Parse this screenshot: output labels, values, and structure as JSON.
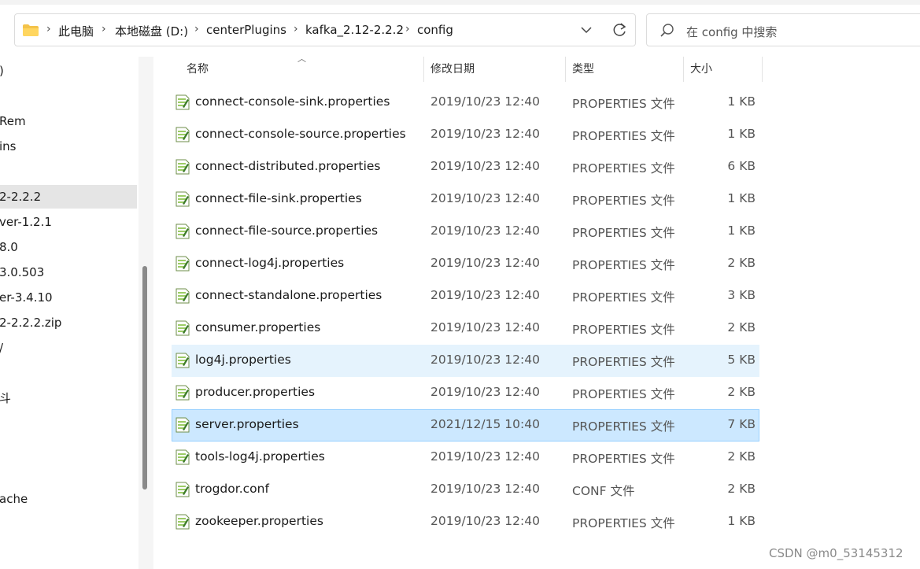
{
  "address_bar": {
    "breadcrumbs": [
      "此电脑",
      "本地磁盘 (D:)",
      "centerPlugins",
      "kafka_2.12-2.2.2",
      "config"
    ]
  },
  "search": {
    "placeholder": "在 config 中搜索"
  },
  "nav_pane": {
    "items": [
      {
        "label": ")",
        "selected": false
      },
      {
        "label": "Rem",
        "selected": false
      },
      {
        "label": "ins",
        "selected": false
      },
      {
        "label": "2-2.2.2",
        "selected": true
      },
      {
        "label": "ver-1.2.1",
        "selected": false
      },
      {
        "label": "8.0",
        "selected": false
      },
      {
        "label": "3.0.503",
        "selected": false
      },
      {
        "label": "er-3.4.10",
        "selected": false
      },
      {
        "label": "2-2.2.2.zip",
        "selected": false
      },
      {
        "label": "/",
        "selected": false
      },
      {
        "label": "斗",
        "selected": false
      },
      {
        "label": "ache",
        "selected": false
      }
    ]
  },
  "columns": {
    "name": "名称",
    "date": "修改日期",
    "type": "类型",
    "size": "大小"
  },
  "files": [
    {
      "name": "connect-console-sink.properties",
      "date": "2019/10/23 12:40",
      "type": "PROPERTIES 文件",
      "size": "1 KB",
      "state": ""
    },
    {
      "name": "connect-console-source.properties",
      "date": "2019/10/23 12:40",
      "type": "PROPERTIES 文件",
      "size": "1 KB",
      "state": ""
    },
    {
      "name": "connect-distributed.properties",
      "date": "2019/10/23 12:40",
      "type": "PROPERTIES 文件",
      "size": "6 KB",
      "state": ""
    },
    {
      "name": "connect-file-sink.properties",
      "date": "2019/10/23 12:40",
      "type": "PROPERTIES 文件",
      "size": "1 KB",
      "state": ""
    },
    {
      "name": "connect-file-source.properties",
      "date": "2019/10/23 12:40",
      "type": "PROPERTIES 文件",
      "size": "1 KB",
      "state": ""
    },
    {
      "name": "connect-log4j.properties",
      "date": "2019/10/23 12:40",
      "type": "PROPERTIES 文件",
      "size": "2 KB",
      "state": ""
    },
    {
      "name": "connect-standalone.properties",
      "date": "2019/10/23 12:40",
      "type": "PROPERTIES 文件",
      "size": "3 KB",
      "state": ""
    },
    {
      "name": "consumer.properties",
      "date": "2019/10/23 12:40",
      "type": "PROPERTIES 文件",
      "size": "2 KB",
      "state": ""
    },
    {
      "name": "log4j.properties",
      "date": "2019/10/23 12:40",
      "type": "PROPERTIES 文件",
      "size": "5 KB",
      "state": "hover"
    },
    {
      "name": "producer.properties",
      "date": "2019/10/23 12:40",
      "type": "PROPERTIES 文件",
      "size": "2 KB",
      "state": ""
    },
    {
      "name": "server.properties",
      "date": "2021/12/15 10:40",
      "type": "PROPERTIES 文件",
      "size": "7 KB",
      "state": "selected"
    },
    {
      "name": "tools-log4j.properties",
      "date": "2019/10/23 12:40",
      "type": "PROPERTIES 文件",
      "size": "2 KB",
      "state": ""
    },
    {
      "name": "trogdor.conf",
      "date": "2019/10/23 12:40",
      "type": "CONF 文件",
      "size": "2 KB",
      "state": ""
    },
    {
      "name": "zookeeper.properties",
      "date": "2019/10/23 12:40",
      "type": "PROPERTIES 文件",
      "size": "1 KB",
      "state": ""
    }
  ],
  "watermark": "CSDN @m0_53145312",
  "colors": {
    "selected_bg": "#cce8ff",
    "hover_bg": "#e5f3fd",
    "nav_selected_bg": "#e5e5e5"
  }
}
